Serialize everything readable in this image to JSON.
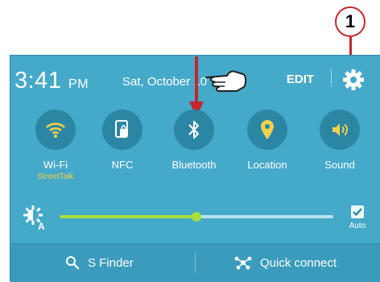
{
  "callout": {
    "number": "1"
  },
  "status": {
    "time": "3:41",
    "ampm": "PM",
    "date": "Sat, October 10"
  },
  "header": {
    "edit_label": "EDIT"
  },
  "tiles": [
    {
      "label": "Wi-Fi",
      "sublabel": "StreetTalk",
      "icon": "wifi-icon"
    },
    {
      "label": "NFC",
      "icon": "nfc-icon"
    },
    {
      "label": "Bluetooth",
      "icon": "bluetooth-icon"
    },
    {
      "label": "Location",
      "icon": "location-icon"
    },
    {
      "label": "Sound",
      "icon": "sound-icon"
    }
  ],
  "brightness": {
    "level": 0.5,
    "auto_label": "Auto",
    "auto_checked": true
  },
  "bottom": {
    "sfinder_label": "S Finder",
    "quick_connect_label": "Quick connect"
  },
  "colors": {
    "panel": "#45a9c9",
    "tile": "#2b86a4",
    "accent": "#a7e03c",
    "annotation": "#c2272d"
  }
}
